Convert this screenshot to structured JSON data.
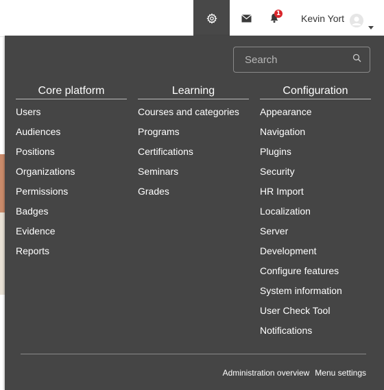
{
  "header": {
    "user_name": "Kevin Yort",
    "notification_count": "1"
  },
  "menu": {
    "search_placeholder": "Search",
    "columns": [
      {
        "heading": "Core platform",
        "items": [
          "Users",
          "Audiences",
          "Positions",
          "Organizations",
          "Permissions",
          "Badges",
          "Evidence",
          "Reports"
        ]
      },
      {
        "heading": "Learning",
        "items": [
          "Courses and categories",
          "Programs",
          "Certifications",
          "Seminars",
          "Grades"
        ]
      },
      {
        "heading": "Configuration",
        "items": [
          "Appearance",
          "Navigation",
          "Plugins",
          "Security",
          "HR Import",
          "Localization",
          "Server",
          "Development",
          "Configure features",
          "System information",
          "User Check Tool",
          "Notifications"
        ]
      }
    ],
    "footer": {
      "admin_overview": "Administration overview",
      "menu_settings": "Menu settings"
    }
  },
  "icons": {
    "settings": "gear-icon",
    "messages": "envelope-icon",
    "notifications": "bell-icon",
    "search": "search-icon",
    "avatar": "user-avatar-icon",
    "caret": "caret-down-icon"
  },
  "colors": {
    "menu_bg": "#454545",
    "active_tab_bg": "#484848",
    "badge": "#d9262b"
  }
}
